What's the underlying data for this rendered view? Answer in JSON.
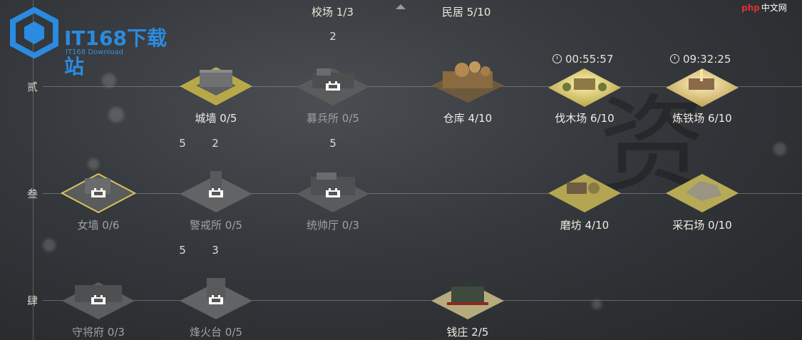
{
  "watermark": {
    "main": "IT168下载站",
    "sub": "IT168 Download",
    "php": "php",
    "php_site": "中文网"
  },
  "background_char": "资",
  "top_bar": {
    "jiaochang": "校场 1/3",
    "minju": "民居 5/10"
  },
  "rows": [
    {
      "label": "贰"
    },
    {
      "label": "叁"
    },
    {
      "label": "肆"
    }
  ],
  "badges": [
    "2",
    "5",
    "2",
    "5",
    "5",
    "3"
  ],
  "timers": [
    "00:55:57",
    "09:32:25"
  ],
  "buildings": [
    {
      "name": "城墙 0/5",
      "state": "unlocked",
      "theme": "wall"
    },
    {
      "name": "募兵所 0/5",
      "state": "locked",
      "theme": "barracks"
    },
    {
      "name": "仓库 4/10",
      "state": "unlocked",
      "theme": "warehouse"
    },
    {
      "name": "伐木场 6/10",
      "state": "upgrading",
      "theme": "lumber"
    },
    {
      "name": "炼铁场 6/10",
      "state": "upgrading",
      "theme": "iron"
    },
    {
      "name": "女墙 0/6",
      "state": "locked-selected",
      "theme": "parapet"
    },
    {
      "name": "警戒所 0/5",
      "state": "locked",
      "theme": "watch"
    },
    {
      "name": "统帅厅 0/3",
      "state": "locked",
      "theme": "hall"
    },
    {
      "name": "磨坊 4/10",
      "state": "unlocked",
      "theme": "mill"
    },
    {
      "name": "采石场 0/10",
      "state": "unlocked",
      "theme": "quarry"
    },
    {
      "name": "守将府 0/3",
      "state": "locked",
      "theme": "mansion"
    },
    {
      "name": "烽火台 0/5",
      "state": "locked",
      "theme": "beacon"
    },
    {
      "name": "钱庄 2/5",
      "state": "unlocked",
      "theme": "bank"
    }
  ],
  "colors": {
    "gold_tile": "#b9a84a",
    "grey_tile": "#6b6c6e",
    "selected_outline": "#d8c25a",
    "glow": "#f2d36a"
  }
}
